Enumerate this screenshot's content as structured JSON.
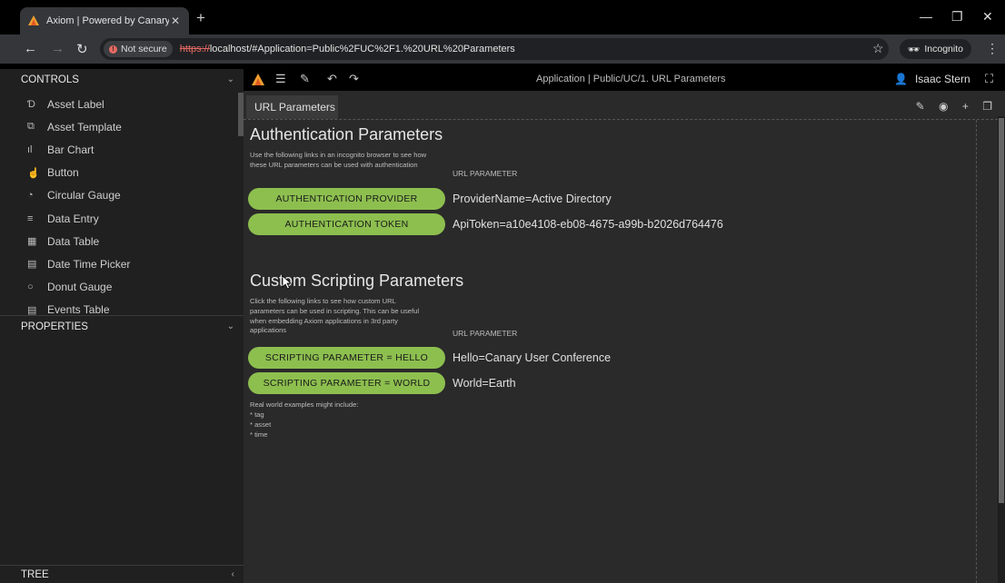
{
  "browser": {
    "tab_title": "Axiom | Powered by Canary Lab",
    "tab_close": "✕",
    "new_tab": "+",
    "security_label": "Not secure",
    "url_scheme": "https://",
    "url_rest": "localhost/#Application=Public%2FUC%2F1.%20URL%20Parameters",
    "incognito_label": "Incognito"
  },
  "left_panel": {
    "controls_label": "CONTROLS",
    "properties_label": "PROPERTIES",
    "tree_label": "TREE",
    "controls": [
      {
        "label": "Asset Label",
        "icon": "asset-label-icon",
        "glyph": "Ɗ"
      },
      {
        "label": "Asset Template",
        "icon": "asset-template-icon",
        "glyph": "⧉"
      },
      {
        "label": "Bar Chart",
        "icon": "bar-chart-icon",
        "glyph": "ıl"
      },
      {
        "label": "Button",
        "icon": "pointer-icon",
        "glyph": "☝"
      },
      {
        "label": "Circular Gauge",
        "icon": "gauge-icon",
        "glyph": "◔"
      },
      {
        "label": "Data Entry",
        "icon": "data-entry-icon",
        "glyph": "≡"
      },
      {
        "label": "Data Table",
        "icon": "table-icon",
        "glyph": "▦"
      },
      {
        "label": "Date Time Picker",
        "icon": "calendar-icon",
        "glyph": "▤"
      },
      {
        "label": "Donut Gauge",
        "icon": "donut-icon",
        "glyph": "○"
      },
      {
        "label": "Events Table",
        "icon": "events-icon",
        "glyph": "▤"
      }
    ]
  },
  "toolbar": {
    "app_title": "Application | Public/UC/1. URL Parameters",
    "user_name": "Isaac Stern"
  },
  "canvas": {
    "page_tab": "URL Parameters",
    "auth": {
      "title": "Authentication Parameters",
      "description": "Use the following links in an incognito browser to see how these URL parameters can be used with authentication",
      "column_label": "URL PARAMETER",
      "buttons": [
        {
          "label": "AUTHENTICATION PROVIDER",
          "param": "ProviderName=Active Directory"
        },
        {
          "label": "AUTHENTICATION TOKEN",
          "param": "ApiToken=a10e4108-eb08-4675-a99b-b2026d764476"
        }
      ]
    },
    "scripting": {
      "title": "Custom Scripting Parameters",
      "description": "Click the following links to see how custom URL parameters can be used in scripting. This can be useful when embedding Axiom applications in 3rd party applications",
      "column_label": "URL PARAMETER",
      "buttons": [
        {
          "label": "SCRIPTING PARAMETER = HELLO",
          "param": "Hello=Canary User Conference"
        },
        {
          "label": "SCRIPTING PARAMETER = WORLD",
          "param": "World=Earth"
        }
      ]
    },
    "examples": [
      "Real world examples might include:",
      "* tag",
      "* asset",
      "* time"
    ]
  },
  "colors": {
    "button_green": "#8dbf4f",
    "canvas_bg": "#2a2a2a",
    "panel_bg": "#202020"
  }
}
